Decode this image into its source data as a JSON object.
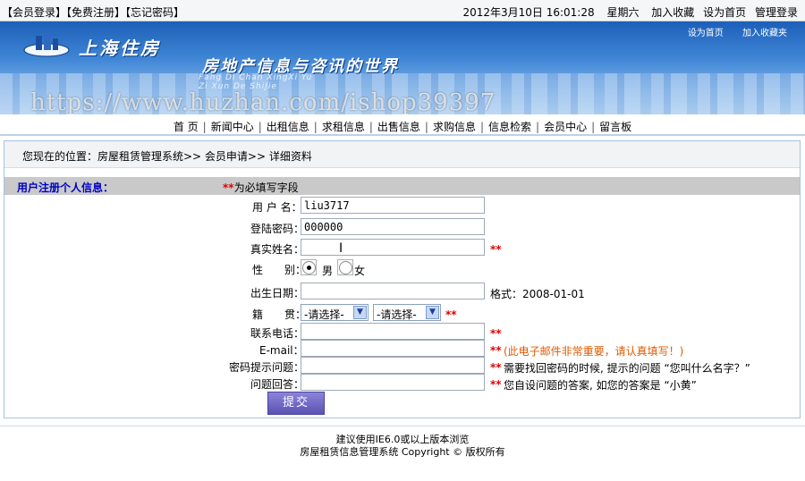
{
  "topbar": {
    "login": "【会员登录】",
    "register": "【免费注册】",
    "forgot": "【忘记密码】",
    "datetime": "2012年3月10日 16:01:28",
    "weekday": "星期六",
    "add_fav": "加入收藏",
    "set_home": "设为首页",
    "admin_login": "管理登录"
  },
  "banner": {
    "logo_name": "上海住房",
    "slogan": "房地产信息与咨讯的世界",
    "pinyin_line1": "Fang Di Chan XingXi Yu",
    "pinyin_line2": "Zi Xun De ShiJie",
    "tool_home": "设为首页",
    "tool_fav": "加入收藏夹",
    "watermark": "https://www.huzhan.com/ishop39397"
  },
  "nav": {
    "items": [
      "首 页",
      "新闻中心",
      "出租信息",
      "求租信息",
      "出售信息",
      "求购信息",
      "信息检索",
      "会员中心",
      "留言板"
    ]
  },
  "breadcrumb": {
    "prefix": "您现在的位置：",
    "path": "房屋租赁管理系统>> 会员申请>> 详细资料"
  },
  "section": {
    "title": "用户注册个人信息：",
    "required_mark": "**",
    "required_note": "为必填写字段"
  },
  "form": {
    "username_label": "用 户 名：",
    "username_value": "liu3717",
    "password_label": "登陆密码：",
    "password_value": "000000",
    "realname_label": "真实姓名：",
    "realname_value": "",
    "gender_label": "性　　别：",
    "gender_male": "男",
    "gender_female": "女",
    "birthday_label": "出生日期：",
    "birthday_value": "",
    "birthday_hint": "格式：2008-01-01",
    "origin_label": "籍　　贯：",
    "province_selected": "-请选择-",
    "city_selected": "-请选择-",
    "phone_label": "联系电话：",
    "phone_value": "",
    "email_label": "E-mail：",
    "email_value": "",
    "email_hint": "(此电子邮件非常重要，请认真填写！)",
    "question_label": "密码提示问题：",
    "question_value": "",
    "question_hint": "需要找回密码的时候, 提示的问题 “您叫什么名字？”",
    "answer_label": "问题回答：",
    "answer_value": "",
    "answer_hint": "您自设问题的答案, 如您的答案是 “小黄”",
    "required_mark": "**",
    "submit_label": "提交"
  },
  "footer": {
    "line1": "建议使用IE6.0或以上版本浏览",
    "line2": "房屋租赁信息管理系统 Copyright © 版权所有"
  }
}
